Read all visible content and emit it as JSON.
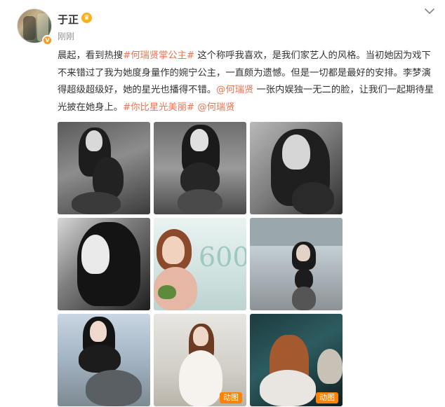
{
  "post": {
    "author_name": "于正",
    "time": "刚刚",
    "text_segments": [
      {
        "text": "晨起，看到热搜",
        "link": false
      },
      {
        "text": "#何瑞贤掌公主#",
        "link": true
      },
      {
        "text": " 这个称呼我喜欢，是我们家艺人的风格。当初她因为戏下不来错过了我为她度身量作的婉宁公主，一直颇为遗憾。但是一切都是最好的安排。李梦演得超级超级好，她的星光也播得不错。",
        "link": false
      },
      {
        "text": "@何瑞贤",
        "link": true
      },
      {
        "text": " 一张内娱独一无二的脸，让我们一起期待星光披在她身上。",
        "link": false
      },
      {
        "text": "#你比星光美丽#",
        "link": true
      },
      {
        "text": " ",
        "link": false
      },
      {
        "text": "@何瑞贤",
        "link": true
      }
    ],
    "images": [
      {
        "name": "photo-1",
        "gif": false
      },
      {
        "name": "photo-2",
        "gif": false
      },
      {
        "name": "photo-3",
        "gif": false
      },
      {
        "name": "photo-4",
        "gif": false
      },
      {
        "name": "photo-5",
        "gif": false
      },
      {
        "name": "photo-6",
        "gif": false
      },
      {
        "name": "photo-7",
        "gif": false
      },
      {
        "name": "photo-8",
        "gif": true,
        "gif_label": "动图"
      },
      {
        "name": "photo-9",
        "gif": true,
        "gif_label": "动图"
      }
    ]
  },
  "icons": {
    "verified": "verified-badge-icon",
    "member": "crown-icon",
    "menu": "chevron-down-icon"
  },
  "colors": {
    "link": "#eb7350",
    "text": "#333333",
    "meta": "#939393",
    "gif_badge": "#ff8200",
    "verified": "#f59b22"
  }
}
